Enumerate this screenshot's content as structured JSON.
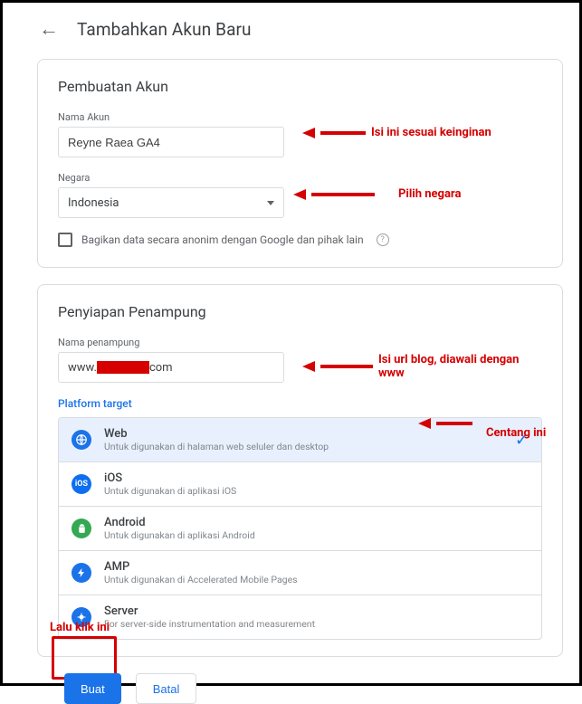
{
  "header": {
    "title": "Tambahkan Akun Baru"
  },
  "account": {
    "card_title": "Pembuatan Akun",
    "name_label": "Nama Akun",
    "name_value": "Reyne Raea GA4",
    "country_label": "Negara",
    "country_value": "Indonesia",
    "anonymous_share": "Bagikan data secara anonim dengan Google dan pihak lain"
  },
  "container": {
    "card_title": "Penyiapan Penampung",
    "name_label": "Nama penampung",
    "name_value_prefix": "www.",
    "name_value_suffix": "com",
    "platform_label": "Platform target",
    "platforms": [
      {
        "name": "Web",
        "desc": "Untuk digunakan di halaman web seluler dan desktop",
        "selected": true
      },
      {
        "name": "iOS",
        "desc": "Untuk digunakan di aplikasi iOS",
        "selected": false
      },
      {
        "name": "Android",
        "desc": "Untuk digunakan di aplikasi Android",
        "selected": false
      },
      {
        "name": "AMP",
        "desc": "Untuk digunakan di Accelerated Mobile Pages",
        "selected": false
      },
      {
        "name": "Server",
        "desc": "For server-side instrumentation and measurement",
        "selected": false
      }
    ]
  },
  "buttons": {
    "create": "Buat",
    "cancel": "Batal"
  },
  "annotations": {
    "name_hint": "Isi ini sesuai keinginan",
    "country_hint": "Pilih negara",
    "url_hint": "Isi url blog, diawali dengan www",
    "check_hint": "Centang ini",
    "click_hint": "Lalu klik ini"
  }
}
